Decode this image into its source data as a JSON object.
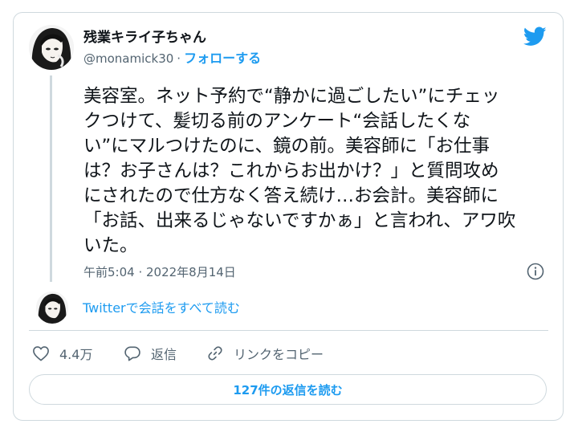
{
  "author": {
    "name": "残業キライ子ちゃん",
    "handle": "@monamick30",
    "separator": "·",
    "follow_label": "フォローする"
  },
  "tweet": {
    "lines": [
      "美容室。ネット予約で“静かに過ごしたい”にチェッ",
      "クつけて、髪切る前のアンケート“会話したくな",
      "い”にマルつけたのに、鏡の前。美容師に「お仕事",
      "は？お子さんは？これからお出かけ？」と質問攻め",
      "にされたので仕方なく答え続け…お会計。美容師に",
      "「お話、出来るじゃないですかぁ」と言われ、アワ吹",
      "いた。"
    ],
    "timestamp": "午前5:04 · 2022年8月14日"
  },
  "conversation_link": "Twitterで会話をすべて読む",
  "actions": {
    "like_count": "4.4万",
    "reply_label": "返信",
    "copy_link_label": "リンクをコピー"
  },
  "read_replies_label": "127件の返信を読む",
  "icons": {
    "brand": "twitter-bird-icon",
    "info": "info-icon",
    "like": "heart-icon",
    "reply": "speech-bubble-icon",
    "copy": "link-icon"
  },
  "colors": {
    "accent": "#1d9bf0",
    "secondary_text": "#536471",
    "border": "#cfd9de"
  }
}
